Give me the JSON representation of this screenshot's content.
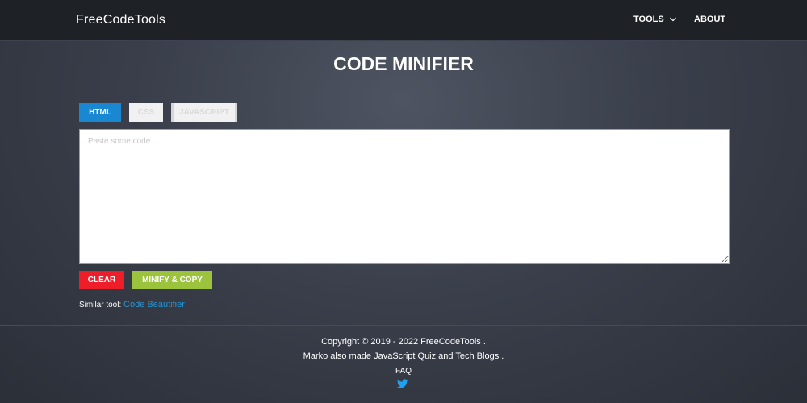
{
  "header": {
    "brand": "FreeCodeTools",
    "nav": {
      "tools_label": "TOOLS",
      "about_label": "ABOUT"
    }
  },
  "main": {
    "title": "CODE MINIFIER",
    "tabs": [
      {
        "label": "HTML",
        "active": true
      },
      {
        "label": "CSS",
        "active": false
      },
      {
        "label": "JAVASCRIPT",
        "active": false
      }
    ],
    "code_input": {
      "value": "",
      "placeholder": "Paste some code"
    },
    "buttons": {
      "clear_label": "CLEAR",
      "minify_label": "MINIFY & COPY"
    },
    "similar_tool": {
      "prefix": "Similar tool:",
      "link_label": "Code Beautifier"
    }
  },
  "footer": {
    "copyright": "Copyright © 2019 - 2022 FreeCodeTools .",
    "made_by": "Marko also made JavaScript Quiz and Tech Blogs .",
    "faq_label": "FAQ",
    "social_icon": "twitter-icon"
  },
  "colors": {
    "navbar_bg": "#1e2126",
    "page_bg": "#3a3f4b",
    "tab_active": "#1a87d2",
    "clear_button": "#ee1d2a",
    "minify_button": "#9bc33b",
    "link": "#2596d6",
    "twitter": "#1da1f2"
  }
}
